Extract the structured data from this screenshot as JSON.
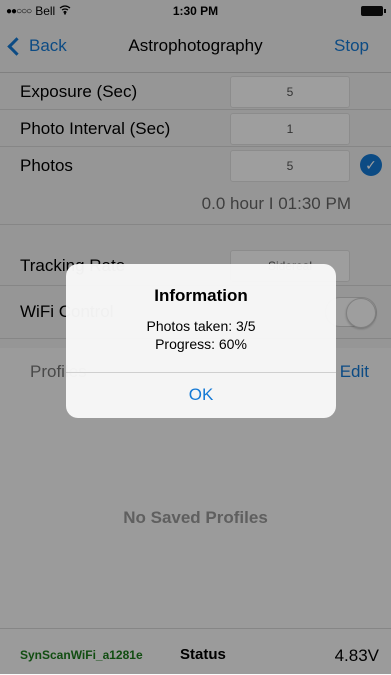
{
  "status_bar": {
    "carrier": "Bell",
    "time": "1:30 PM"
  },
  "nav": {
    "back_label": "Back",
    "title": "Astrophotography",
    "action_label": "Stop"
  },
  "settings": {
    "exposure": {
      "label": "Exposure (Sec)",
      "value": "5"
    },
    "interval": {
      "label": "Photo Interval (Sec)",
      "value": "1"
    },
    "photos": {
      "label": "Photos",
      "value": "5",
      "checked": true
    },
    "duration_summary": "0.0 hour  I  01:30 PM",
    "tracking_rate": {
      "label": "Tracking Rate",
      "value": "Sidereal"
    },
    "wifi": {
      "label": "WiFi Control"
    }
  },
  "profiles": {
    "title": "Profiles",
    "edit_label": "Edit",
    "empty_text": "No Saved Profiles"
  },
  "footer": {
    "device_name": "SynScanWiFi_a1281e",
    "status_label": "Status",
    "voltage": "4.83V"
  },
  "alert": {
    "title": "Information",
    "line1": "Photos taken: 3/5",
    "line2": "Progress: 60%",
    "button_label": "OK"
  },
  "colors": {
    "accent": "#1479d5",
    "device_name": "#1c7d1c"
  }
}
